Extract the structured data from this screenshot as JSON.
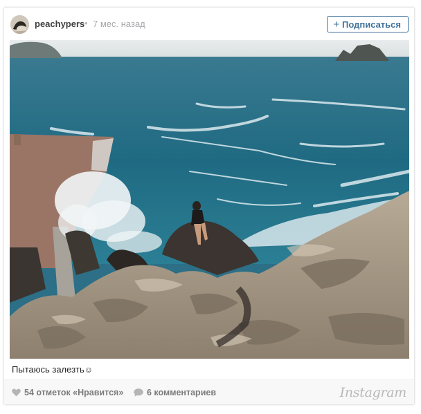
{
  "post": {
    "username": "peachypers",
    "separator": "•",
    "time": "7 мес. назад",
    "follow_label": "Подписаться",
    "follow_icon": "plus-icon",
    "caption_text": "Пытаюсь залезть",
    "caption_emoji": "☺",
    "likes_text": "54 отметок «Нравится»",
    "comments_text": "6 комментариев",
    "brand": "Instagram",
    "like_icon": "heart-icon",
    "comment_icon": "speech-bubble-icon"
  },
  "colors": {
    "accent": "#3f729b",
    "muted": "#a5a7aa",
    "sea": "#2c6f86",
    "footer_bg": "#f8f8f8"
  }
}
